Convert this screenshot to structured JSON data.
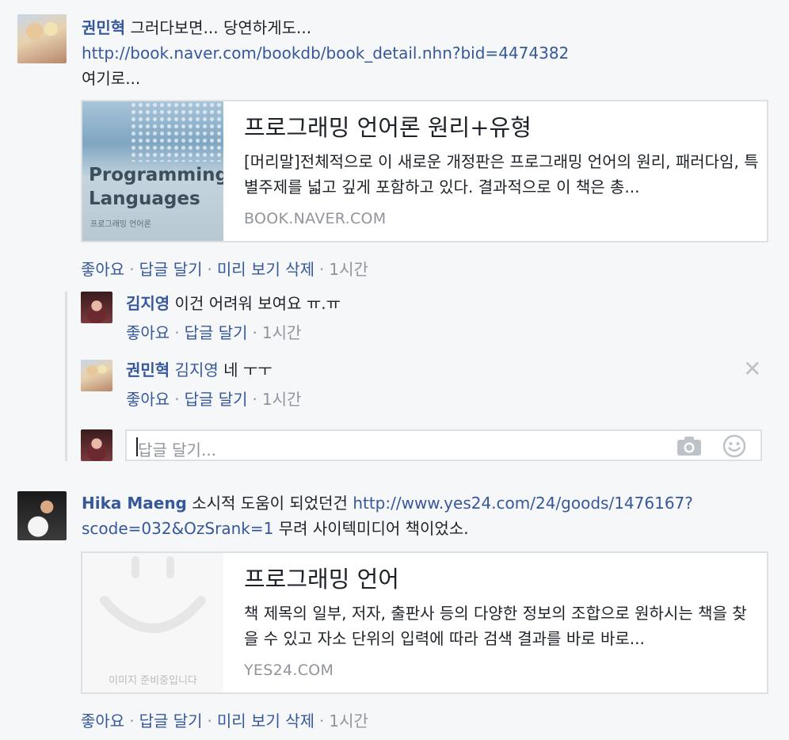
{
  "post1": {
    "author": "권민혁",
    "text": " 그러다보면... 당연하게도...",
    "link": "http://book.naver.com/bookdb/book_detail.nhn?bid=4474382",
    "text2": "여기로...",
    "card": {
      "title": "프로그래밍 언어론 원리+유형",
      "desc": "[머리말]전체적으로 이 새로운 개정판은 프로그래밍 언어의 원리, 패러다임, 특별주제를 넓고 깊게 포함하고 있다. 결과적으로 이 책은 총...",
      "domain": "BOOK.NAVER.COM",
      "thumb_line1": "Programming",
      "thumb_line2": "Languages",
      "thumb_line3": "프로그래밍 언어론"
    },
    "actions": {
      "like": "좋아요",
      "reply": "답글 달기",
      "remove_preview": "미리 보기 삭제",
      "time": "1시간"
    }
  },
  "reply1": {
    "author": "김지영",
    "text": " 이건 어려워 보여요 ㅠ.ㅠ",
    "like": "좋아요",
    "reply": "답글 달기",
    "time": "1시간"
  },
  "reply2": {
    "author": "권민혁",
    "mention": "김지영",
    "text": " 네 ㅜㅜ",
    "like": "좋아요",
    "reply": "답글 달기",
    "time": "1시간",
    "close_glyph": "✕"
  },
  "reply_input": {
    "placeholder": "답글 달기..."
  },
  "post2": {
    "author": "Hika Maeng",
    "text": " 소시적 도움이 되었던건 ",
    "link_part1": "http://www.yes24.com/24/goods/1476167?",
    "link_part2": "scode=032&OzSrank=1",
    "text2": " 무려 사이텍미디어 책이었소.",
    "card": {
      "title": "프로그래밍 언어",
      "desc": "책 제목의 일부, 저자, 출판사 등의 다양한 정보의 조합으로 원하시는 책을 찾을 수 있고 자소 단위의 입력에 따라 검색 결과를 바로 바로...",
      "domain": "YES24.COM",
      "thumb_caption": "이미지 준비중입니다"
    },
    "actions": {
      "like": "좋아요",
      "reply": "답글 달기",
      "remove_preview": "미리 보기 삭제",
      "time": "1시간"
    }
  },
  "separator": "·",
  "icons": [
    "camera-icon",
    "smiley-icon",
    "close-icon"
  ],
  "colors": {
    "link": "#365899",
    "muted": "#90949c",
    "border": "#dddfe2",
    "background": "#f6f7f9"
  }
}
